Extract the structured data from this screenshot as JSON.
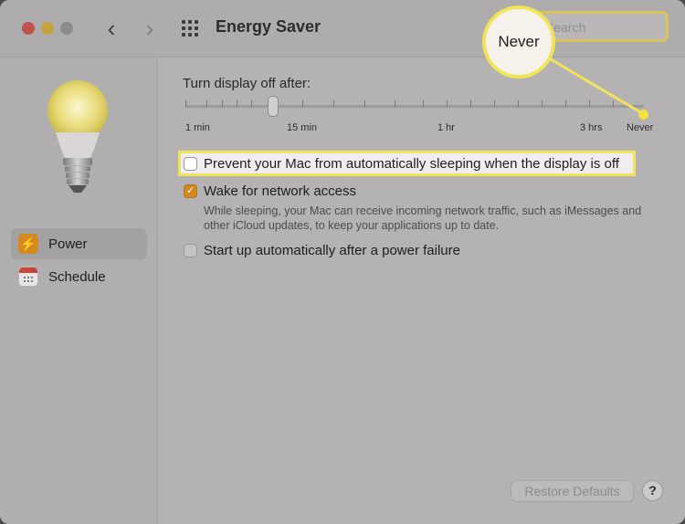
{
  "window": {
    "title": "Energy Saver"
  },
  "search": {
    "placeholder": "Search"
  },
  "callout": {
    "text": "Never"
  },
  "sidebar": {
    "items": [
      {
        "label": "Power",
        "icon": "bolt-icon",
        "selected": true
      },
      {
        "label": "Schedule",
        "icon": "calendar-icon",
        "selected": false
      }
    ]
  },
  "display_sleep": {
    "label": "Turn display off after:",
    "ticks": [
      "1 min",
      "15 min",
      "1 hr",
      "3 hrs",
      "Never"
    ]
  },
  "options": {
    "prevent_sleep": {
      "label": "Prevent your Mac from automatically sleeping when the display is off",
      "checked": false
    },
    "wake_network": {
      "label": "Wake for network access",
      "checked": true,
      "description": "While sleeping, your Mac can receive incoming network traffic, such as iMessages and other iCloud updates, to keep your applications up to date."
    },
    "power_failure": {
      "label": "Start up automatically after a power failure",
      "checked": false
    }
  },
  "footer": {
    "restore_label": "Restore Defaults",
    "help_label": "?"
  },
  "colors": {
    "accent": "#d0891f",
    "highlight": "#f1e45a"
  }
}
